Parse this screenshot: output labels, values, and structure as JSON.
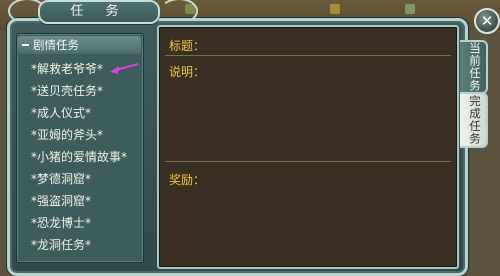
{
  "window": {
    "title": "任 务",
    "close_glyph": "✕"
  },
  "quest_list": {
    "header": "剧情任务",
    "items": [
      "*解救老爷爷*",
      "*送贝壳任务*",
      "*成人仪式*",
      "*亚姆的斧头*",
      "*小猪的爱情故事*",
      "*梦德洞窟*",
      "*强盗洞窟*",
      "*恐龙博士*",
      "*龙洞任务*"
    ]
  },
  "detail": {
    "title_label": "标题：",
    "description_label": "说明：",
    "reward_label": "奖励："
  },
  "side_tabs": {
    "current": "当前任务",
    "completed": "完成任务"
  },
  "colors": {
    "label_gold": "#f0c93a",
    "pointer_arrow": "#e040e0",
    "panel_teal": "#3e5b5d"
  }
}
